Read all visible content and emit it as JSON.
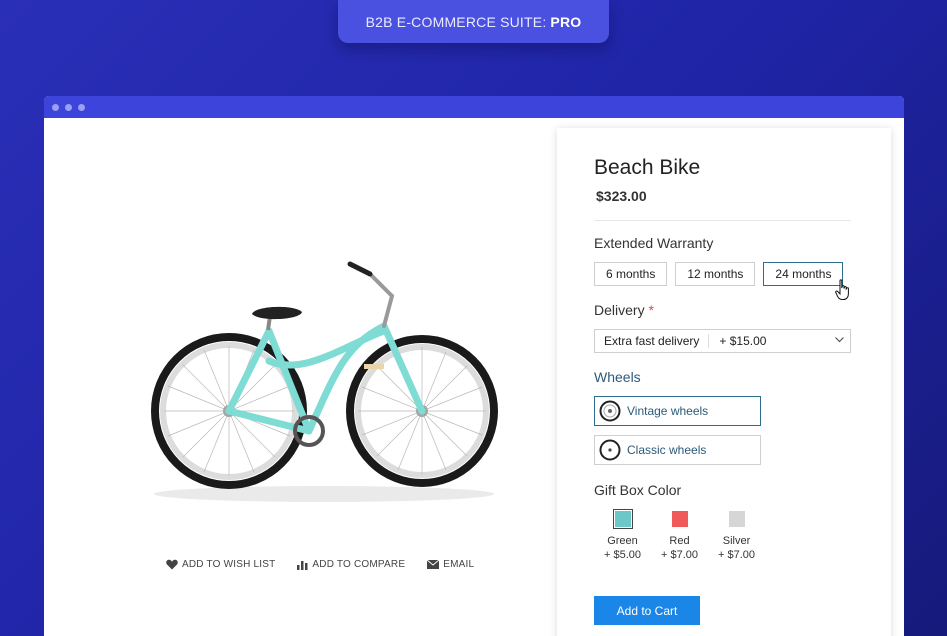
{
  "badge": {
    "prefix": "B2B E-COMMERCE SUITE:",
    "strong": "PRO"
  },
  "product": {
    "title": "Beach Bike",
    "price": "$323.00"
  },
  "actions": [
    {
      "label": "ADD TO WISH LIST",
      "icon": "heart-icon"
    },
    {
      "label": "ADD TO COMPARE",
      "icon": "bar-chart-icon"
    },
    {
      "label": "EMAIL",
      "icon": "envelope-icon"
    }
  ],
  "warranty": {
    "label": "Extended Warranty",
    "options": [
      "6 months",
      "12 months",
      "24 months"
    ],
    "selected": "24 months"
  },
  "delivery": {
    "label": "Delivery",
    "required_mark": "*",
    "selected_option": "Extra fast delivery",
    "selected_fee": "+ $15.00"
  },
  "wheels": {
    "label": "Wheels",
    "options": [
      {
        "label": "Vintage wheels",
        "selected": true
      },
      {
        "label": "Classic wheels",
        "selected": false
      }
    ]
  },
  "gift_box": {
    "label": "Gift Box Color",
    "options": [
      {
        "name": "Green",
        "fee": "+ $5.00",
        "color": "#6cc7c7",
        "selected": true
      },
      {
        "name": "Red",
        "fee": "+ $7.00",
        "color": "#f05a5a",
        "selected": false
      },
      {
        "name": "Silver",
        "fee": "+ $7.00",
        "color": "#d6d6d6",
        "selected": false
      }
    ]
  },
  "cart": {
    "label": "Add to Cart"
  },
  "colors": {
    "accent": "#1a86e8",
    "frame_blue": "#3d44dc",
    "bike_teal": "#7fdcd4"
  }
}
